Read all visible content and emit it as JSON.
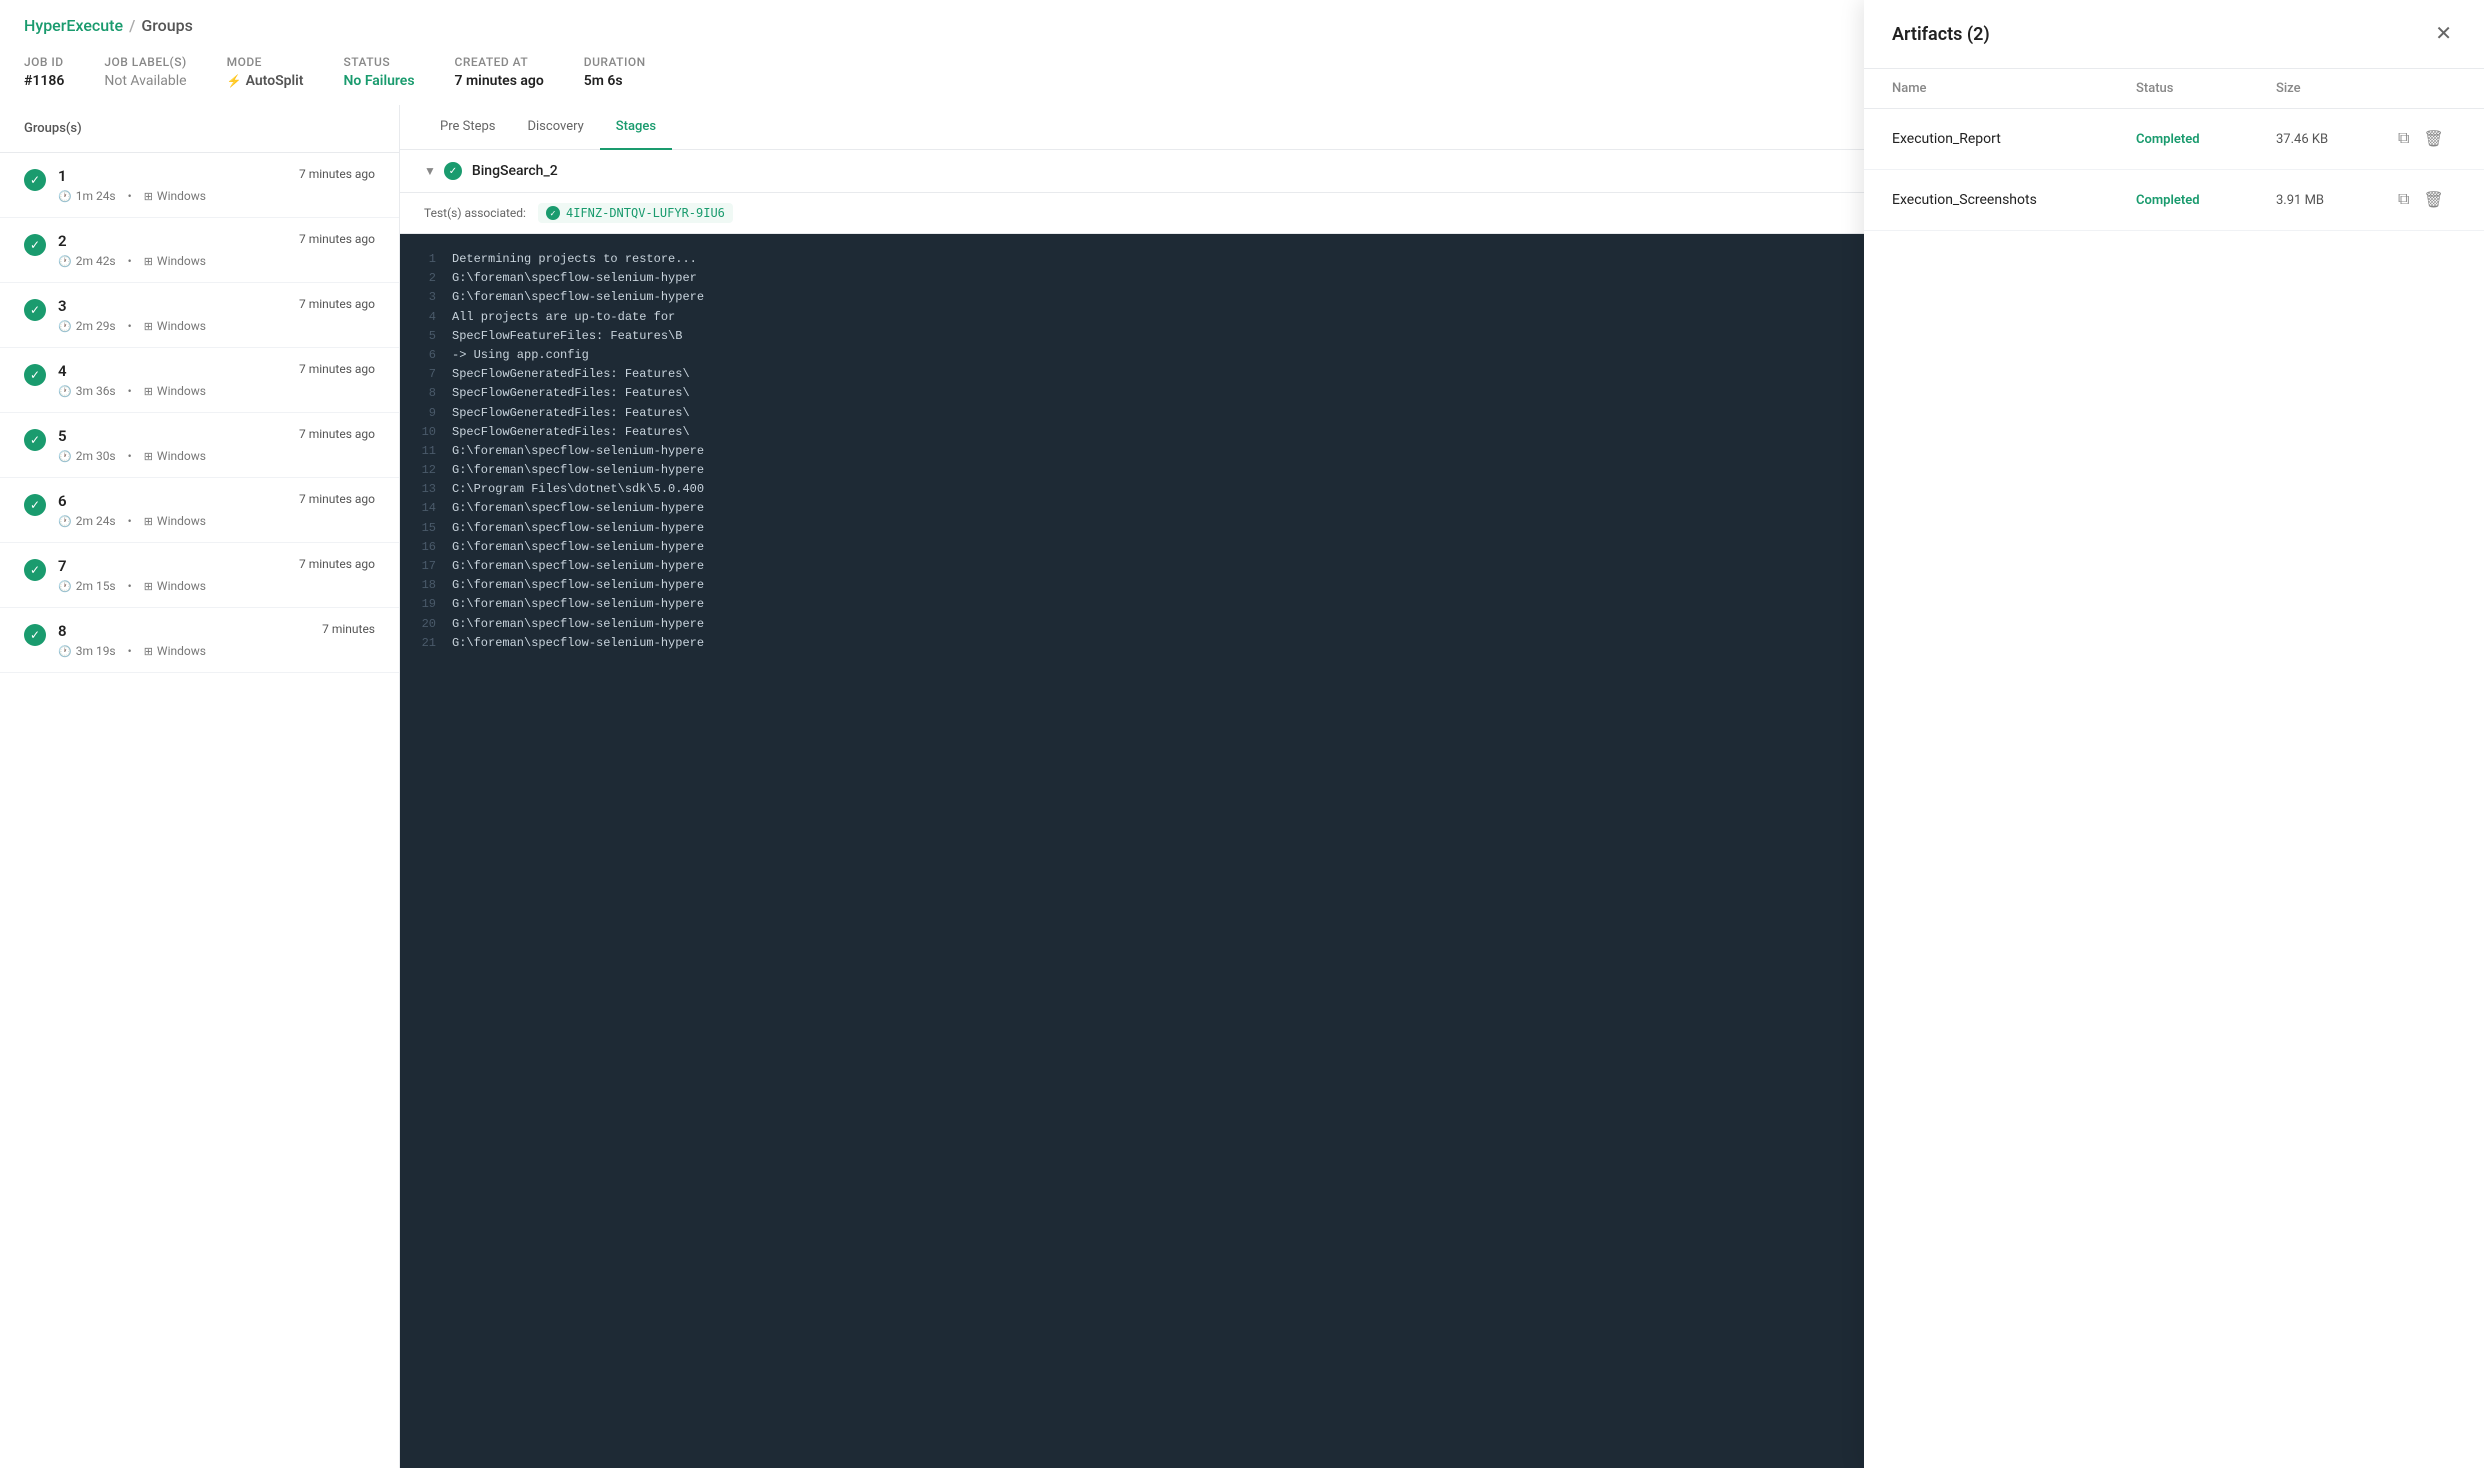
{
  "breadcrumb": {
    "link_text": "HyperExecute",
    "separator": "/",
    "current": "Groups"
  },
  "job": {
    "id_label": "Job ID",
    "id_value": "#1186",
    "label_label": "Job Label(s)",
    "label_value": "Not Available",
    "mode_label": "Mode",
    "mode_value": "AutoSplit",
    "status_label": "Status",
    "status_value": "No Failures",
    "created_label": "Created at",
    "created_value": "7 minutes ago",
    "duration_label": "Duration",
    "duration_value": "5m 6s"
  },
  "groups_header": "Groups(s)",
  "groups": [
    {
      "number": "1",
      "duration": "1m 24s",
      "os": "Windows",
      "time": "7 minutes ago"
    },
    {
      "number": "2",
      "duration": "2m 42s",
      "os": "Windows",
      "time": "7 minutes ago"
    },
    {
      "number": "3",
      "duration": "2m 29s",
      "os": "Windows",
      "time": "7 minutes ago"
    },
    {
      "number": "4",
      "duration": "3m 36s",
      "os": "Windows",
      "time": "7 minutes ago"
    },
    {
      "number": "5",
      "duration": "2m 30s",
      "os": "Windows",
      "time": "7 minutes ago"
    },
    {
      "number": "6",
      "duration": "2m 24s",
      "os": "Windows",
      "time": "7 minutes ago"
    },
    {
      "number": "7",
      "duration": "2m 15s",
      "os": "Windows",
      "time": "7 minutes ago"
    },
    {
      "number": "8",
      "duration": "3m 19s",
      "os": "Windows",
      "time": "7 minutes"
    }
  ],
  "tabs": [
    {
      "label": "Pre Steps",
      "active": false
    },
    {
      "label": "Discovery",
      "active": false
    },
    {
      "label": "Stages",
      "active": true
    }
  ],
  "stage": {
    "name": "BingSearch_2",
    "test_assoc_label": "Test(s) associated:",
    "test_id": "4IFNZ-DNTQV-LUFYR-9IU6"
  },
  "log_lines": [
    {
      "num": "1",
      "text": "  Determining projects to restore..."
    },
    {
      "num": "2",
      "text": "G:\\foreman\\specflow-selenium-hyper"
    },
    {
      "num": "3",
      "text": "G:\\foreman\\specflow-selenium-hypere"
    },
    {
      "num": "4",
      "text": "    All projects are up-to-date for"
    },
    {
      "num": "5",
      "text": "    SpecFlowFeatureFiles: Features\\B"
    },
    {
      "num": "6",
      "text": "  -> Using app.config"
    },
    {
      "num": "7",
      "text": "    SpecFlowGeneratedFiles: Features\\"
    },
    {
      "num": "8",
      "text": "    SpecFlowGeneratedFiles: Features\\"
    },
    {
      "num": "9",
      "text": "    SpecFlowGeneratedFiles: Features\\"
    },
    {
      "num": "10",
      "text": "    SpecFlowGeneratedFiles: Features\\"
    },
    {
      "num": "11",
      "text": "G:\\foreman\\specflow-selenium-hypere"
    },
    {
      "num": "12",
      "text": "G:\\foreman\\specflow-selenium-hypere"
    },
    {
      "num": "13",
      "text": "C:\\Program Files\\dotnet\\sdk\\5.0.400"
    },
    {
      "num": "14",
      "text": "G:\\foreman\\specflow-selenium-hypere"
    },
    {
      "num": "15",
      "text": "G:\\foreman\\specflow-selenium-hypere"
    },
    {
      "num": "16",
      "text": "G:\\foreman\\specflow-selenium-hypere"
    },
    {
      "num": "17",
      "text": "G:\\foreman\\specflow-selenium-hypere"
    },
    {
      "num": "18",
      "text": "G:\\foreman\\specflow-selenium-hypere"
    },
    {
      "num": "19",
      "text": "G:\\foreman\\specflow-selenium-hypere"
    },
    {
      "num": "20",
      "text": "G:\\foreman\\specflow-selenium-hypere"
    },
    {
      "num": "21",
      "text": "G:\\foreman\\specflow-selenium-hypere"
    }
  ],
  "artifacts_panel": {
    "title": "Artifacts (2)",
    "col_name": "Name",
    "col_status": "Status",
    "col_size": "Size",
    "items": [
      {
        "name": "Execution_Report",
        "status": "Completed",
        "size": "37.46 KB"
      },
      {
        "name": "Execution_Screenshots",
        "status": "Completed",
        "size": "3.91 MB"
      }
    ]
  }
}
